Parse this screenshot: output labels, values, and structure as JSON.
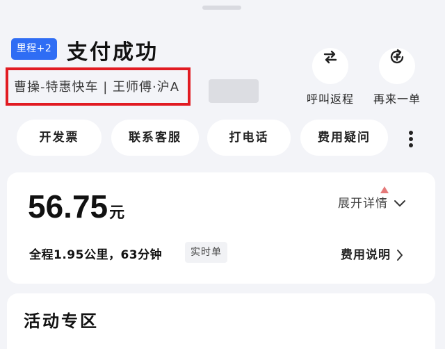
{
  "header": {
    "badge": "里程+2",
    "title": "支付成功",
    "subtitle": "曹操-特惠快车 | 王师傅·沪A",
    "actions": [
      {
        "label": "呼叫返程",
        "icon": "swap-arrows-icon"
      },
      {
        "label": "再来一单",
        "icon": "reorder-icon"
      }
    ]
  },
  "quick_actions": [
    "开发票",
    "联系客服",
    "打电话",
    "费用疑问"
  ],
  "payment": {
    "amount": "56.75",
    "unit": "元",
    "expand_label": "展开详情",
    "trip_summary": "全程1.95公里，63分钟",
    "trip_tag": "实时单",
    "fee_note": "费用说明"
  },
  "activity": {
    "title": "活动专区"
  },
  "colors": {
    "badge_bg": "#2f6df4",
    "highlight_border": "#e11b22",
    "page_bg": "#f3f4f8"
  }
}
